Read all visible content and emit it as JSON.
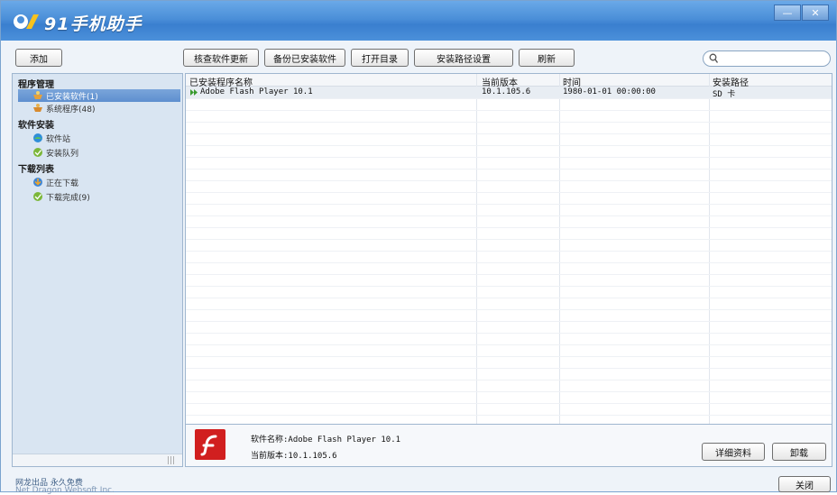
{
  "app": {
    "title": "91手机助手"
  },
  "window": {
    "minimize_icon": "minimize-icon",
    "close_icon": "close-icon"
  },
  "toolbar": {
    "add_label": "添加",
    "check_updates_label": "核查软件更新",
    "backup_label": "备份已安装软件",
    "open_dir_label": "打开目录",
    "install_path_label": "安装路径设置",
    "refresh_label": "刷新",
    "search_icon": "search-icon"
  },
  "sidebar": {
    "groups": [
      {
        "title": "程序管理",
        "items": [
          {
            "label": "已安装软件(1)",
            "icon": "installed-apps-icon",
            "selected": true
          },
          {
            "label": "系统程序(48)",
            "icon": "system-apps-icon"
          }
        ]
      },
      {
        "title": "软件安装",
        "items": [
          {
            "label": "软件站",
            "icon": "software-store-icon"
          },
          {
            "label": "安装队列",
            "icon": "install-queue-icon"
          }
        ]
      },
      {
        "title": "下载列表",
        "items": [
          {
            "label": "正在下载",
            "icon": "downloading-icon"
          },
          {
            "label": "下载完成(9)",
            "icon": "download-complete-icon"
          }
        ]
      }
    ],
    "scroll_grip": "|||"
  },
  "list": {
    "columns": [
      "已安装程序名称",
      "当前版本",
      "时间",
      "安装路径"
    ],
    "rows": [
      {
        "name": "Adobe Flash Player 10.1",
        "version": "10.1.105.6",
        "time": "1980-01-01 00:00:00",
        "path": "SD 卡"
      }
    ]
  },
  "detail": {
    "name_line": "软件名称:Adobe Flash Player 10.1",
    "version_line": "当前版本:10.1.105.6",
    "details_label": "详细资料",
    "uninstall_label": "卸载",
    "icon": "flash-player-icon"
  },
  "footer": {
    "line1": "网龙出品 永久免费",
    "line2": "Net Dragon Websoft Inc.",
    "close_label": "关闭"
  },
  "colors": {
    "titlebar": "#4b8fd8",
    "selection": "#6b98d3",
    "border": "#9fb6cf"
  }
}
